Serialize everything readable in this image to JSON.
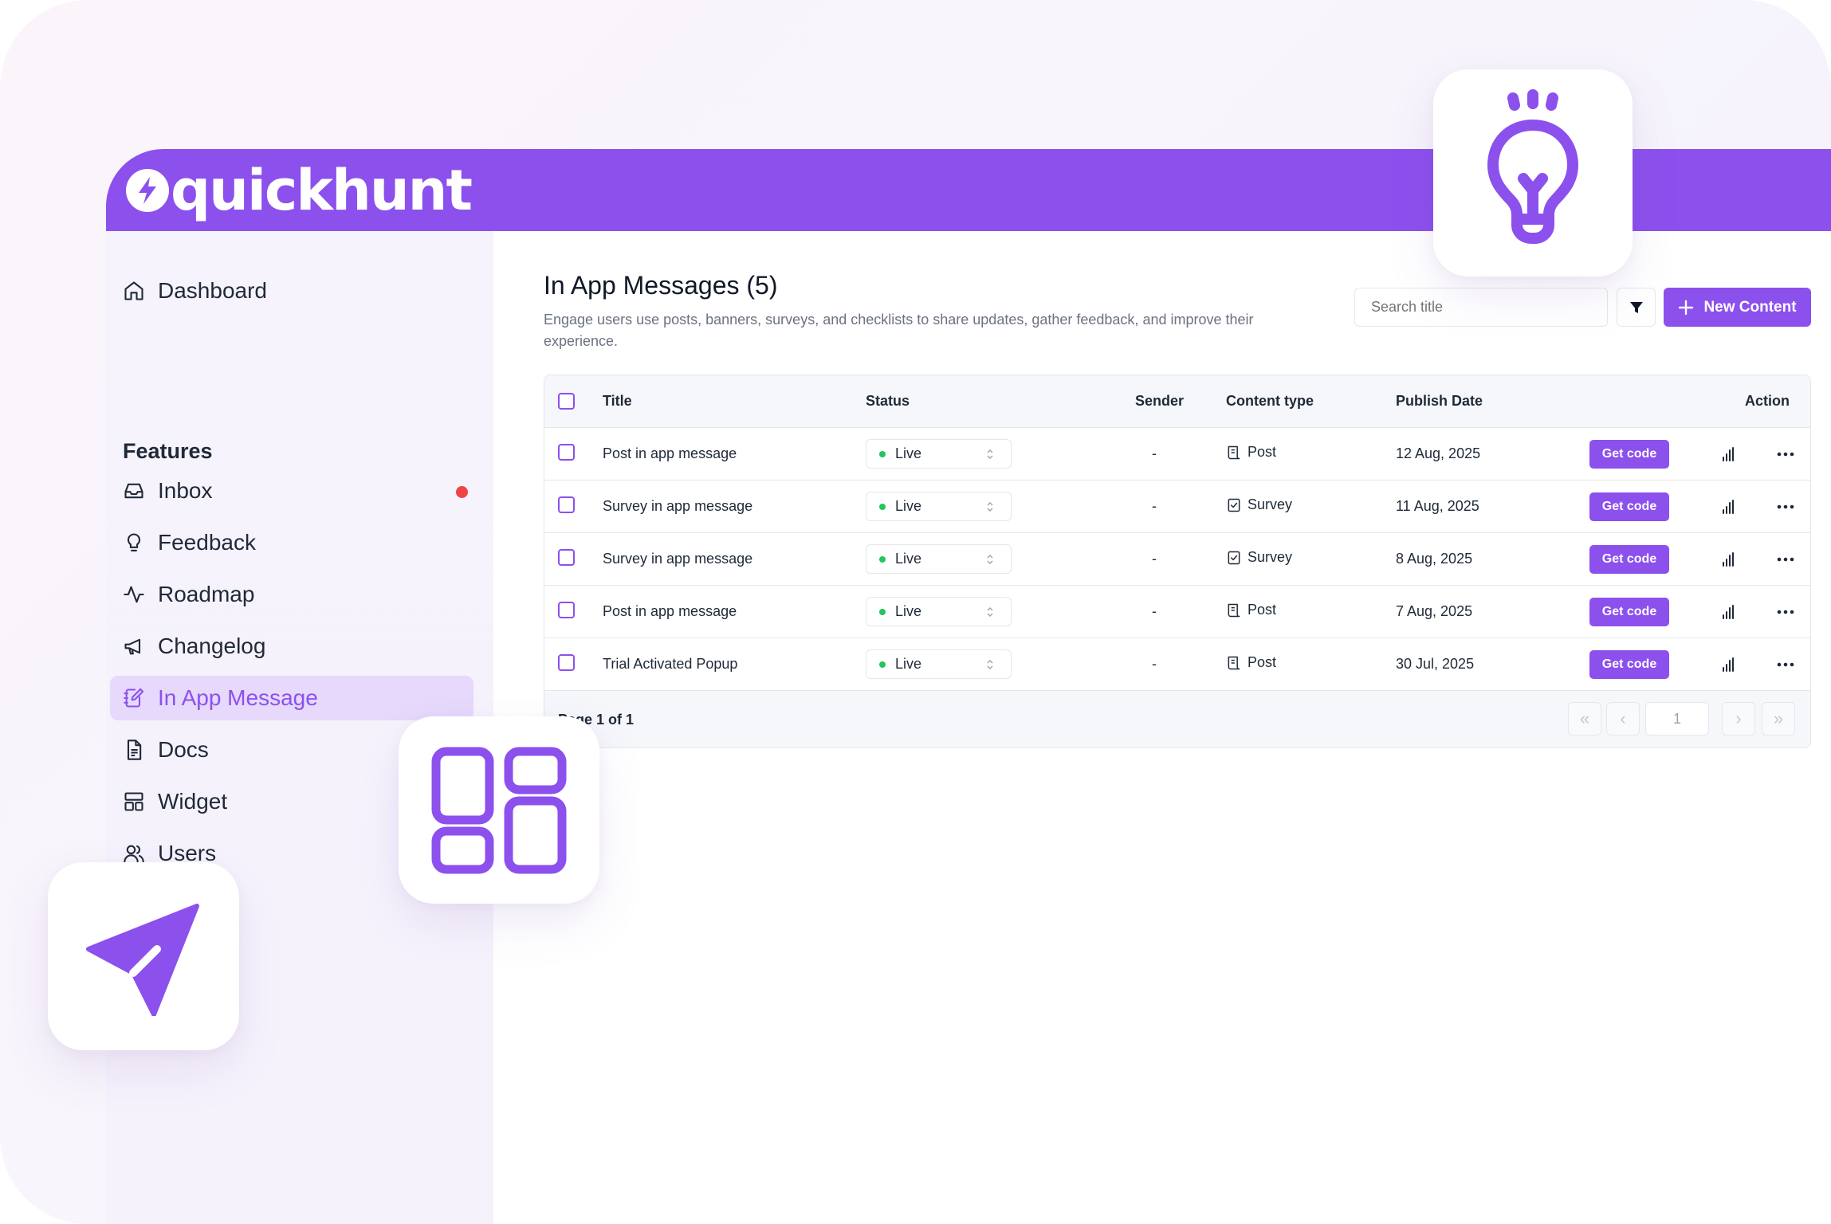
{
  "app": {
    "brand": "quickhunt"
  },
  "sidebar": {
    "dashboard": "Dashboard",
    "section_label": "Features",
    "items": [
      {
        "label": "Inbox",
        "icon": "inbox-icon",
        "has_notification": true
      },
      {
        "label": "Feedback",
        "icon": "lightbulb-icon"
      },
      {
        "label": "Roadmap",
        "icon": "activity-icon"
      },
      {
        "label": "Changelog",
        "icon": "megaphone-icon"
      },
      {
        "label": "In App Message",
        "icon": "edit-note-icon",
        "active": true
      },
      {
        "label": "Docs",
        "icon": "document-icon"
      },
      {
        "label": "Widget",
        "icon": "layout-icon"
      },
      {
        "label": "Users",
        "icon": "users-icon"
      }
    ]
  },
  "header": {
    "title": "In App Messages (5)",
    "description": "Engage users use posts, banners, surveys, and checklists to share updates, gather feedback, and improve their experience.",
    "search_placeholder": "Search title",
    "new_button": "New Content"
  },
  "table": {
    "columns": [
      "Title",
      "Status",
      "Sender",
      "Content type",
      "Publish Date",
      "Action"
    ],
    "rows": [
      {
        "title": "Post in app message",
        "status": "Live",
        "sender": "-",
        "type": "Post",
        "date": "12 Aug, 2025",
        "action": "Get code"
      },
      {
        "title": "Survey in app message",
        "status": "Live",
        "sender": "-",
        "type": "Survey",
        "date": "11 Aug, 2025",
        "action": "Get code"
      },
      {
        "title": "Survey in app message",
        "status": "Live",
        "sender": "-",
        "type": "Survey",
        "date": "8 Aug, 2025",
        "action": "Get code"
      },
      {
        "title": "Post in app message",
        "status": "Live",
        "sender": "-",
        "type": "Post",
        "date": "7 Aug, 2025",
        "action": "Get code"
      },
      {
        "title": "Trial Activated Popup",
        "status": "Live",
        "sender": "-",
        "type": "Post",
        "date": "30 Jul, 2025",
        "action": "Get code"
      }
    ]
  },
  "pagination": {
    "info": "Page 1 of 1",
    "current_page": "1"
  },
  "colors": {
    "brand": "#8c50ed",
    "live": "#22c55e",
    "notification": "#ef4444"
  }
}
